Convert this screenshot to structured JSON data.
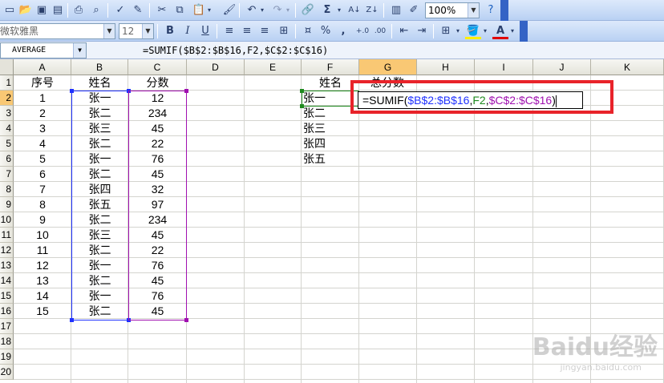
{
  "toolbar_formatting": {
    "zoom": "100%",
    "font_name": "微软雅黑",
    "font_size": "12",
    "bold": "B",
    "italic": "I",
    "underline": "U",
    "percent": "%",
    "comma": ","
  },
  "formula_bar": {
    "name_box": "AVERAGE",
    "formula": "=SUMIF($B$2:$B$16,F2,$C$2:$C$16)"
  },
  "columns": [
    "A",
    "B",
    "C",
    "D",
    "E",
    "F",
    "G",
    "H",
    "I",
    "J",
    "K"
  ],
  "rows": [
    "1",
    "2",
    "3",
    "4",
    "5",
    "6",
    "7",
    "8",
    "9",
    "10",
    "11",
    "12",
    "13",
    "14",
    "15",
    "16",
    "17",
    "18",
    "19",
    "20"
  ],
  "table": {
    "header": {
      "a": "序号",
      "b": "姓名",
      "c": "分数"
    },
    "records": [
      {
        "a": "1",
        "b": "张一",
        "c": "12"
      },
      {
        "a": "2",
        "b": "张二",
        "c": "234"
      },
      {
        "a": "3",
        "b": "张三",
        "c": "45"
      },
      {
        "a": "4",
        "b": "张二",
        "c": "22"
      },
      {
        "a": "5",
        "b": "张一",
        "c": "76"
      },
      {
        "a": "6",
        "b": "张二",
        "c": "45"
      },
      {
        "a": "7",
        "b": "张四",
        "c": "32"
      },
      {
        "a": "8",
        "b": "张五",
        "c": "97"
      },
      {
        "a": "9",
        "b": "张二",
        "c": "234"
      },
      {
        "a": "10",
        "b": "张三",
        "c": "45"
      },
      {
        "a": "11",
        "b": "张二",
        "c": "22"
      },
      {
        "a": "12",
        "b": "张一",
        "c": "76"
      },
      {
        "a": "13",
        "b": "张二",
        "c": "45"
      },
      {
        "a": "14",
        "b": "张一",
        "c": "76"
      },
      {
        "a": "15",
        "b": "张二",
        "c": "45"
      }
    ]
  },
  "summary": {
    "header_f": "姓名",
    "header_g": "总分数",
    "names": [
      "张一",
      "张二",
      "张三",
      "张四",
      "张五"
    ]
  },
  "editing": {
    "prefix": "=SUMIF(",
    "ref1": "$B$2:$B$16",
    "comma1": ",",
    "ref2": "F2",
    "comma2": ",",
    "ref3": "$C$2:$C$16",
    "suffix": ")"
  },
  "colors": {
    "ref1": "#2032ff",
    "ref2": "#1f8a1f",
    "ref3": "#a010b0",
    "callout": "#e8232a",
    "active_header": "#f9c874"
  },
  "watermark": {
    "brand": "Baidu经验",
    "url": "jingyan.baidu.com"
  }
}
